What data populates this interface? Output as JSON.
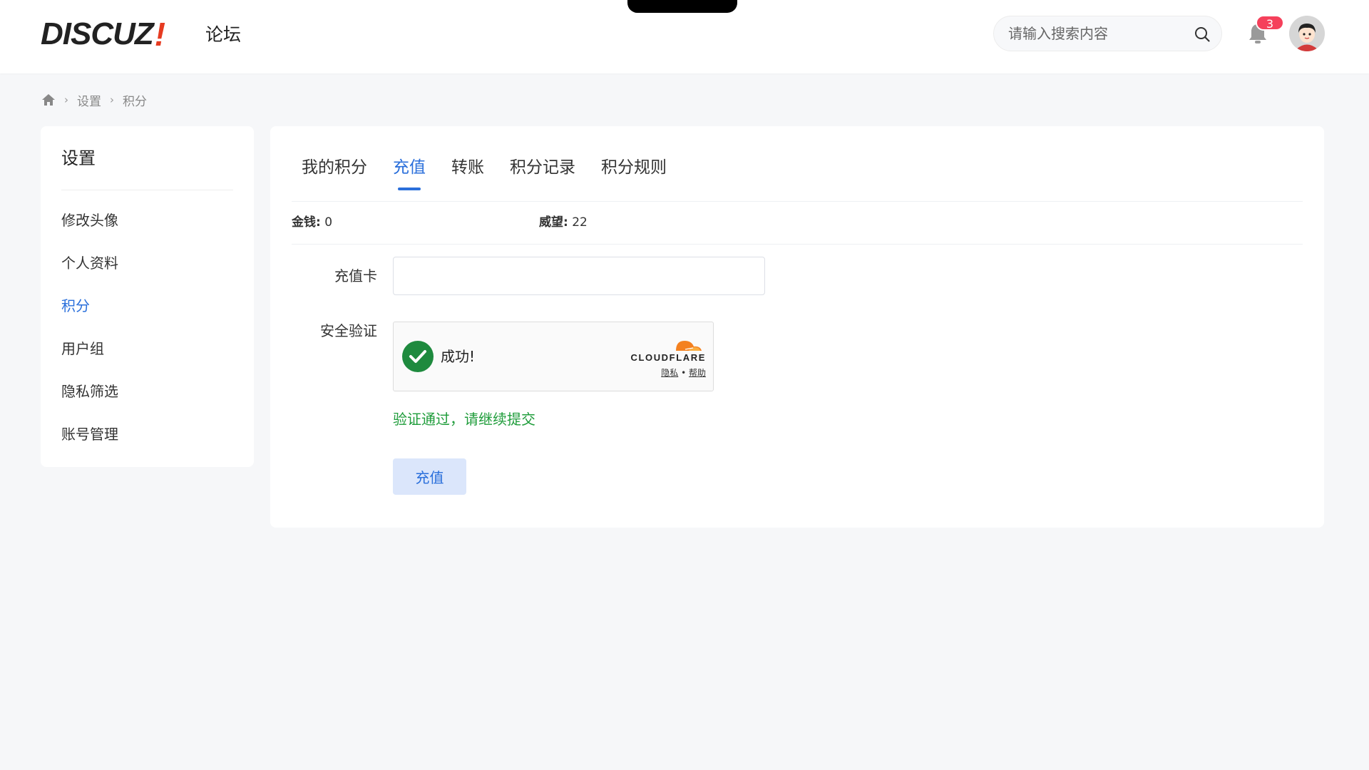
{
  "header": {
    "logo_text": "DISCUZ",
    "logo_mark": "!",
    "site_name": "论坛",
    "search_placeholder": "请输入搜索内容",
    "search_icon": "search-icon",
    "notification_icon": "bell-icon",
    "notification_count": "3",
    "avatar": "user-avatar"
  },
  "breadcrumb": {
    "home_icon": "home-icon",
    "separator": "›",
    "items": [
      "设置",
      "积分"
    ]
  },
  "sidebar": {
    "title": "设置",
    "items": [
      {
        "label": "修改头像",
        "active": false
      },
      {
        "label": "个人资料",
        "active": false
      },
      {
        "label": "积分",
        "active": true
      },
      {
        "label": "用户组",
        "active": false
      },
      {
        "label": "隐私筛选",
        "active": false
      },
      {
        "label": "账号管理",
        "active": false
      }
    ]
  },
  "main": {
    "tabs": [
      {
        "label": "我的积分",
        "active": false
      },
      {
        "label": "充值",
        "active": true
      },
      {
        "label": "转账",
        "active": false
      },
      {
        "label": "积分记录",
        "active": false
      },
      {
        "label": "积分规则",
        "active": false
      }
    ],
    "stats": [
      {
        "label": "金钱:",
        "value": "0"
      },
      {
        "label": "威望:",
        "value": "22"
      }
    ],
    "form": {
      "card_label": "充值卡",
      "card_value": "",
      "verify_label": "安全验证",
      "turnstile": {
        "status_text": "成功!",
        "status_icon": "check-circle-icon",
        "brand": "CLOUDFLARE",
        "privacy_link": "隐私",
        "link_sep": "•",
        "help_link": "帮助"
      },
      "verify_message": "验证通过，请继续提交",
      "submit_label": "充值"
    }
  },
  "colors": {
    "accent": "#2a6fdb",
    "success": "#1e9c3a",
    "badge": "#f5405b",
    "logo_mark": "#e63b21",
    "cloudflare_orange": "#f48120"
  }
}
